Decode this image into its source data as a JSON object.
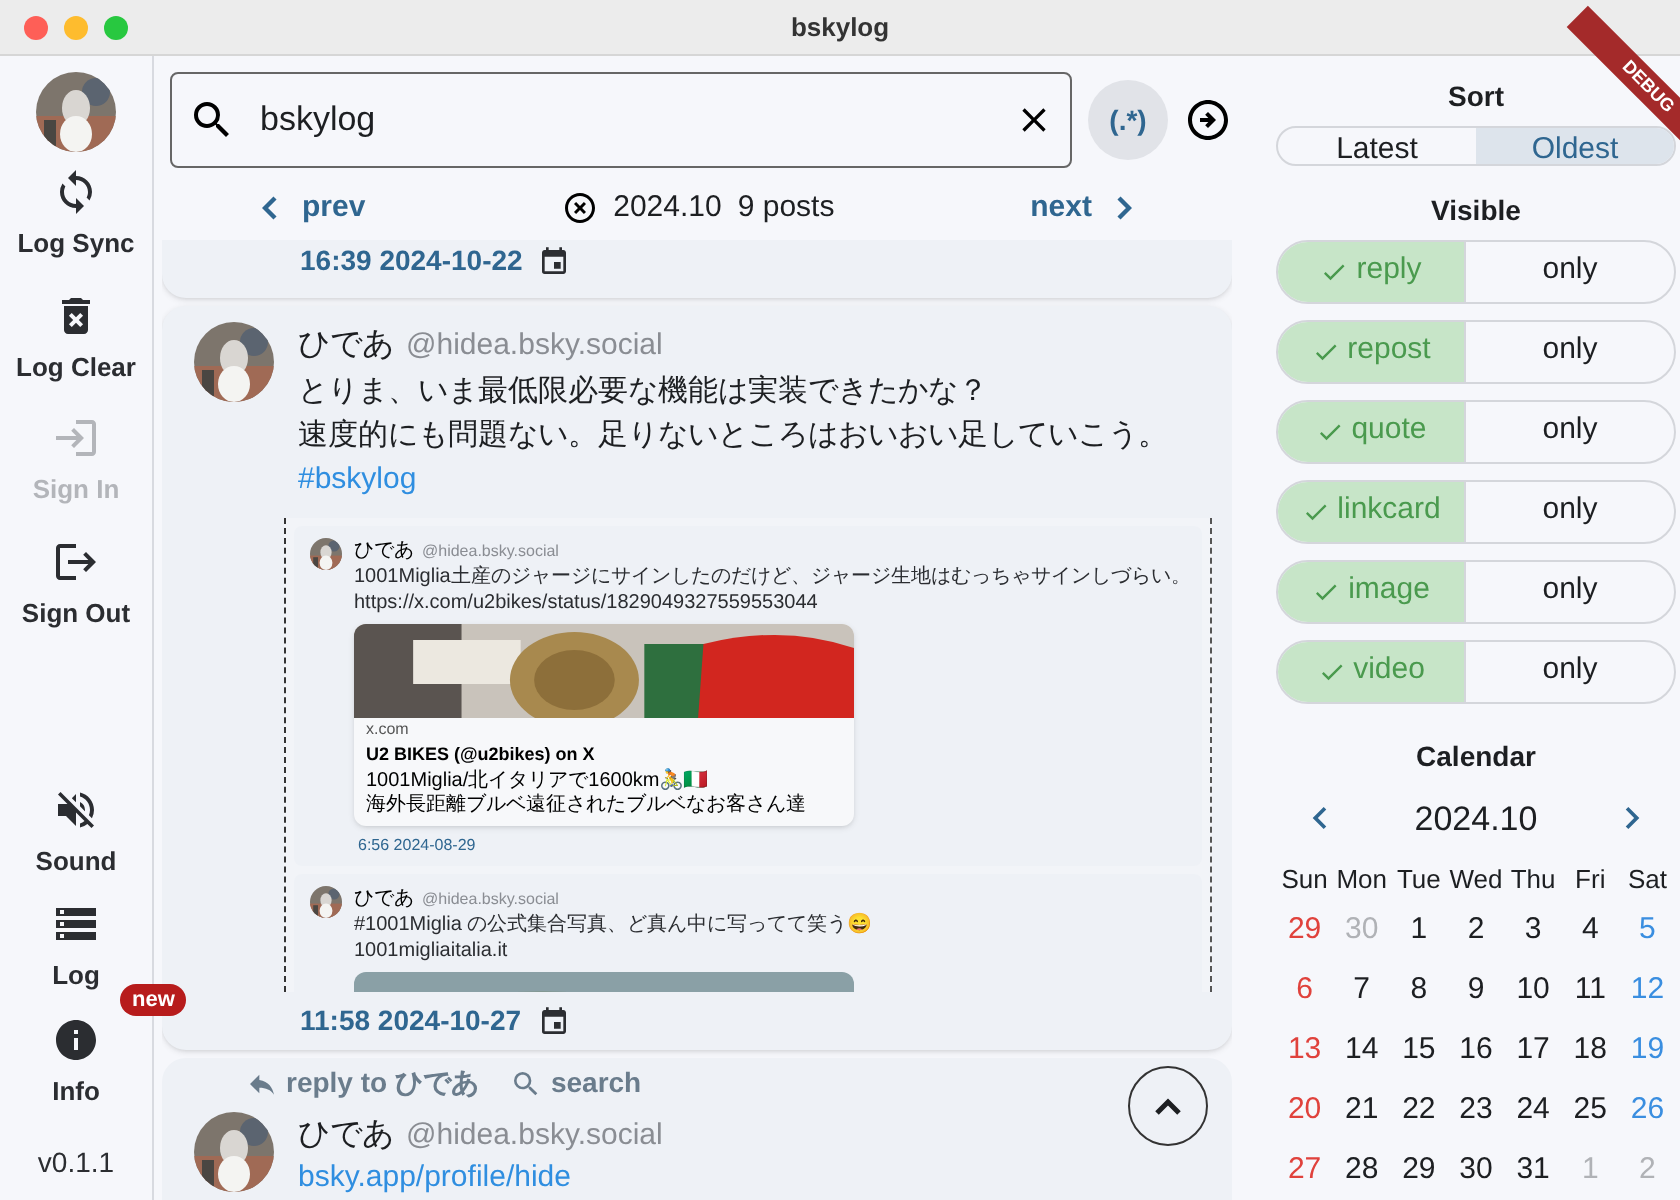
{
  "window": {
    "title": "bskylog"
  },
  "sidebar": {
    "top_items": [
      {
        "label": "Log Sync",
        "disabled": false
      },
      {
        "label": "Log Clear",
        "disabled": false
      },
      {
        "label": "Sign In",
        "disabled": true
      },
      {
        "label": "Sign Out",
        "disabled": false
      }
    ],
    "bottom_items": [
      {
        "label": "Sound",
        "disabled": false
      },
      {
        "label": "Log",
        "disabled": false
      },
      {
        "label": "Info",
        "disabled": false,
        "badge": "new"
      }
    ],
    "version": "v0.1.1"
  },
  "search": {
    "value": "bskylog",
    "regex": {
      "label": "(.*)",
      "on": true
    }
  },
  "nav": {
    "prev": "prev",
    "month": "2024.10",
    "count": "9 posts",
    "next": "next"
  },
  "posts": [
    {
      "kind": "tail",
      "time": "16:39 2024-10-22"
    },
    {
      "kind": "full",
      "name": "ひであ",
      "handle": "@hidea.bsky.social",
      "lines": [
        "とりま、いま最低限必要な機能は実装できたかな？",
        "速度的にも問題ない。足りないところはおいおい足していこう。"
      ],
      "tag": "#bskylog",
      "embed": {
        "posts": [
          {
            "name": "ひであ",
            "handle": "@hidea.bsky.social",
            "lines": [
              "1001Miglia土産のジャージにサインしたのだけど、ジャージ生地はむっちゃサインしづらい。",
              "https://x.com/u2bikes/status/1829049327559553044"
            ],
            "card": {
              "site": "x.com",
              "title": "U2 BIKES (@u2bikes) on X",
              "lines": [
                "1001Miglia/北イタリアで1600km🚴🇮🇹",
                "海外長距離ブルベ遠征されたブルベなお客さん達"
              ]
            },
            "time": "6:56 2024-08-29"
          },
          {
            "name": "ひであ",
            "handle": "@hidea.bsky.social",
            "lines": [
              "#1001Miglia の公式集合写真、ど真ん中に写ってて笑う😄",
              "1001migliaitalia.it"
            ],
            "image": {
              "kind": "picture"
            }
          }
        ]
      },
      "time": "11:58 2024-10-27"
    },
    {
      "kind": "head",
      "reply_to": "reply to ひであ",
      "search": "search",
      "name": "ひであ",
      "handle": "@hidea.bsky.social",
      "link": "bsky.app/profile/hide"
    }
  ],
  "sort": {
    "title": "Sort",
    "options": [
      {
        "label": "Latest",
        "selected": false
      },
      {
        "label": "Oldest",
        "selected": true
      }
    ]
  },
  "visible": {
    "title": "Visible",
    "filters": [
      {
        "label": "reply",
        "on": true,
        "only": "only"
      },
      {
        "label": "repost",
        "on": true,
        "only": "only"
      },
      {
        "label": "quote",
        "on": true,
        "only": "only"
      },
      {
        "label": "linkcard",
        "on": true,
        "only": "only"
      },
      {
        "label": "image",
        "on": true,
        "only": "only"
      },
      {
        "label": "video",
        "on": true,
        "only": "only"
      }
    ]
  },
  "calendar": {
    "title": "Calendar",
    "month": "2024.10",
    "weekdays": [
      "Sun",
      "Mon",
      "Tue",
      "Wed",
      "Thu",
      "Fri",
      "Sat"
    ],
    "weeks": [
      [
        {
          "day": "29",
          "muted": false
        },
        {
          "day": "30",
          "muted": true
        },
        {
          "day": "1",
          "muted": false
        },
        {
          "day": "2",
          "muted": false
        },
        {
          "day": "3",
          "muted": false
        },
        {
          "day": "4",
          "muted": false
        },
        {
          "day": "5",
          "muted": false
        }
      ],
      [
        {
          "day": "6",
          "muted": false
        },
        {
          "day": "7",
          "muted": false
        },
        {
          "day": "8",
          "muted": false
        },
        {
          "day": "9",
          "muted": false
        },
        {
          "day": "10",
          "muted": false
        },
        {
          "day": "11",
          "muted": false
        },
        {
          "day": "12",
          "muted": false
        }
      ],
      [
        {
          "day": "13",
          "muted": false
        },
        {
          "day": "14",
          "muted": false
        },
        {
          "day": "15",
          "muted": false
        },
        {
          "day": "16",
          "muted": false
        },
        {
          "day": "17",
          "muted": false
        },
        {
          "day": "18",
          "muted": false
        },
        {
          "day": "19",
          "muted": false
        }
      ],
      [
        {
          "day": "20",
          "muted": false
        },
        {
          "day": "21",
          "muted": false
        },
        {
          "day": "22",
          "muted": false
        },
        {
          "day": "23",
          "muted": false
        },
        {
          "day": "24",
          "muted": false
        },
        {
          "day": "25",
          "muted": false
        },
        {
          "day": "26",
          "muted": false
        }
      ],
      [
        {
          "day": "27",
          "muted": false
        },
        {
          "day": "28",
          "muted": false
        },
        {
          "day": "29",
          "muted": false
        },
        {
          "day": "30",
          "muted": false
        },
        {
          "day": "31",
          "muted": false
        },
        {
          "day": "1",
          "muted": true
        },
        {
          "day": "2",
          "muted": true
        }
      ]
    ]
  },
  "debug_banner": "DEBUG"
}
